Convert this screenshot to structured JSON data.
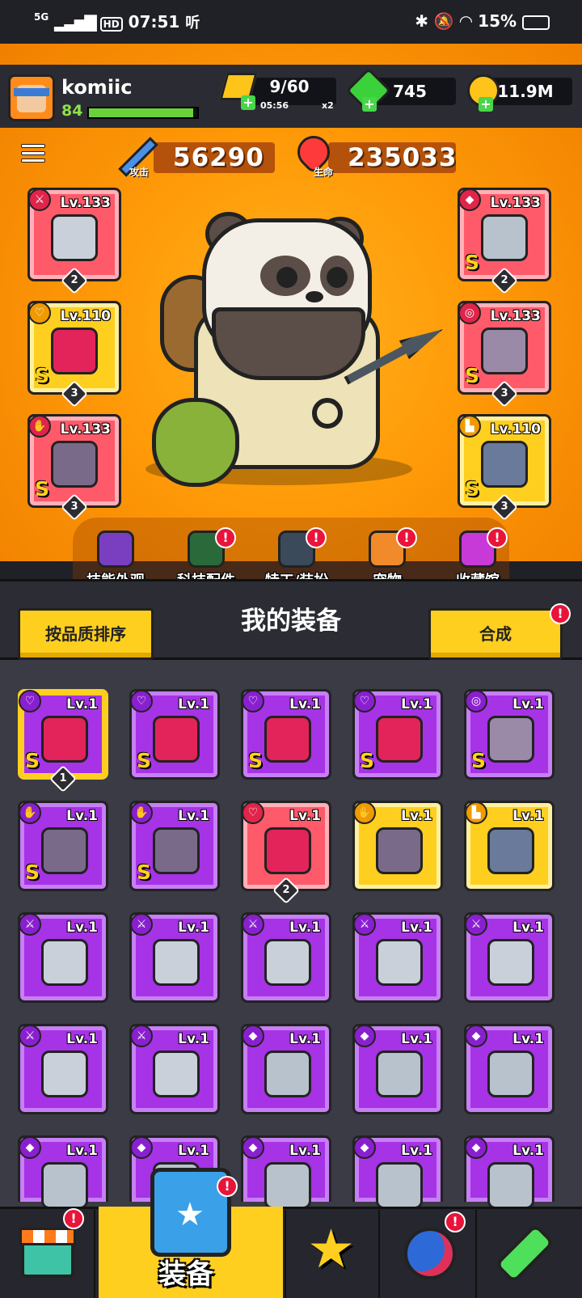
{
  "status_bar": {
    "network": "5G",
    "hd": "HD",
    "time": "07:51",
    "extra": "听",
    "battery": "15%"
  },
  "player": {
    "name": "komiic",
    "level": "84",
    "xp_fraction": 0.96
  },
  "resources": {
    "energy": {
      "value": "9/60",
      "timer": "05:56",
      "multiplier": "x2"
    },
    "gems": {
      "value": "745"
    },
    "coins": {
      "value": "11.9M"
    }
  },
  "stats": {
    "attack": {
      "value": "56290",
      "label": "攻击"
    },
    "hp": {
      "value": "235033",
      "label": "生命"
    }
  },
  "equipped": {
    "left": [
      {
        "level": "Lv.133",
        "grade": "",
        "stars": "2",
        "color": "red",
        "slot": "weapon-icon"
      },
      {
        "level": "Lv.110",
        "grade": "S",
        "stars": "3",
        "color": "yellow",
        "slot": "necklace-icon"
      },
      {
        "level": "Lv.133",
        "grade": "S",
        "stars": "3",
        "color": "red",
        "slot": "glove-icon"
      }
    ],
    "right": [
      {
        "level": "Lv.133",
        "grade": "S",
        "stars": "2",
        "color": "red",
        "slot": "armor-icon"
      },
      {
        "level": "Lv.133",
        "grade": "S",
        "stars": "3",
        "color": "red",
        "slot": "belt-icon"
      },
      {
        "level": "Lv.110",
        "grade": "S",
        "stars": "3",
        "color": "yellow",
        "slot": "boots-icon"
      }
    ]
  },
  "feature_menu": [
    {
      "label": "技能外观",
      "badge": false
    },
    {
      "label": "科技配件",
      "badge": true
    },
    {
      "label": "特工/装扮",
      "badge": true
    },
    {
      "label": "宠物",
      "badge": true
    },
    {
      "label": "收藏馆",
      "badge": true
    }
  ],
  "panel": {
    "sort_button": "按品质排序",
    "title": "我的装备",
    "merge_button": "合成",
    "merge_badge": "!"
  },
  "inventory_rows": [
    [
      {
        "level": "Lv.1",
        "grade": "S",
        "stars": "1",
        "color": "purple",
        "slot": "necklace-icon",
        "selected": true
      },
      {
        "level": "Lv.1",
        "grade": "S",
        "stars": "",
        "color": "purple",
        "slot": "necklace-icon"
      },
      {
        "level": "Lv.1",
        "grade": "S",
        "stars": "",
        "color": "purple",
        "slot": "necklace-icon"
      },
      {
        "level": "Lv.1",
        "grade": "S",
        "stars": "",
        "color": "purple",
        "slot": "necklace-icon"
      },
      {
        "level": "Lv.1",
        "grade": "S",
        "stars": "",
        "color": "purple",
        "slot": "belt-icon"
      }
    ],
    [
      {
        "level": "Lv.1",
        "grade": "S",
        "stars": "",
        "color": "purple",
        "slot": "glove-icon"
      },
      {
        "level": "Lv.1",
        "grade": "S",
        "stars": "",
        "color": "purple",
        "slot": "glove-icon"
      },
      {
        "level": "Lv.1",
        "grade": "",
        "stars": "2",
        "color": "red",
        "slot": "necklace-icon"
      },
      {
        "level": "Lv.1",
        "grade": "",
        "stars": "",
        "color": "yellow",
        "slot": "glove-icon"
      },
      {
        "level": "Lv.1",
        "grade": "",
        "stars": "",
        "color": "yellow",
        "slot": "boots-icon"
      }
    ],
    [
      {
        "level": "Lv.1",
        "grade": "",
        "stars": "",
        "color": "purple",
        "slot": "weapon-icon"
      },
      {
        "level": "Lv.1",
        "grade": "",
        "stars": "",
        "color": "purple",
        "slot": "weapon-icon"
      },
      {
        "level": "Lv.1",
        "grade": "",
        "stars": "",
        "color": "purple",
        "slot": "weapon-icon"
      },
      {
        "level": "Lv.1",
        "grade": "",
        "stars": "",
        "color": "purple",
        "slot": "weapon-icon"
      },
      {
        "level": "Lv.1",
        "grade": "",
        "stars": "",
        "color": "purple",
        "slot": "weapon-icon"
      }
    ],
    [
      {
        "level": "Lv.1",
        "grade": "",
        "stars": "",
        "color": "purple",
        "slot": "weapon-icon"
      },
      {
        "level": "Lv.1",
        "grade": "",
        "stars": "",
        "color": "purple",
        "slot": "weapon-icon"
      },
      {
        "level": "Lv.1",
        "grade": "",
        "stars": "",
        "color": "purple",
        "slot": "armor-icon"
      },
      {
        "level": "Lv.1",
        "grade": "",
        "stars": "",
        "color": "purple",
        "slot": "armor-icon"
      },
      {
        "level": "Lv.1",
        "grade": "",
        "stars": "",
        "color": "purple",
        "slot": "armor-icon"
      }
    ],
    [
      {
        "level": "Lv.1",
        "grade": "",
        "stars": "",
        "color": "purple",
        "slot": "armor-icon"
      },
      {
        "level": "Lv.1",
        "grade": "",
        "stars": "",
        "color": "purple",
        "slot": "armor-icon"
      },
      {
        "level": "Lv.1",
        "grade": "",
        "stars": "",
        "color": "purple",
        "slot": "armor-icon"
      },
      {
        "level": "Lv.1",
        "grade": "",
        "stars": "",
        "color": "purple",
        "slot": "armor-icon"
      },
      {
        "level": "Lv.1",
        "grade": "",
        "stars": "",
        "color": "purple",
        "slot": "armor-icon"
      }
    ]
  ],
  "bottom_nav": {
    "selected_label": "装备",
    "items": [
      "shop-icon",
      "equipment-icon",
      "star-swords-icon",
      "planet-icon",
      "test-tube-icon"
    ]
  },
  "colors": {
    "red": "#ff5a6a",
    "yellow": "#ffcf1f",
    "purple": "#a633e6",
    "accent": "#ffcf1f"
  }
}
